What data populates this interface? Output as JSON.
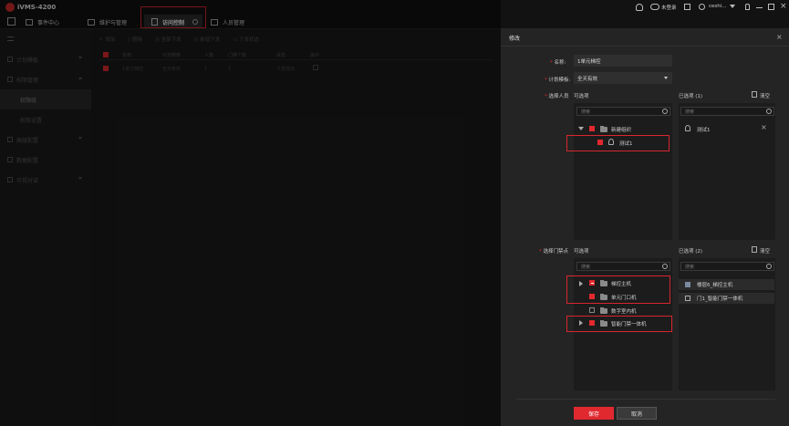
{
  "app": {
    "title": "iVMS-4200",
    "user": "ceshi...",
    "login_status": "未登录"
  },
  "tabs": [
    {
      "label": "事件中心"
    },
    {
      "label": "维护与管理"
    },
    {
      "label": "访问控制"
    },
    {
      "label": "人员管理"
    }
  ],
  "sidebar": {
    "items": [
      {
        "label": "计划模板"
      },
      {
        "label": "权限管理"
      },
      {
        "label": "权限组"
      },
      {
        "label": "权限设置"
      },
      {
        "label": "高级配置"
      },
      {
        "label": "数据配置"
      },
      {
        "label": "可视对讲"
      }
    ]
  },
  "toolbar": {
    "add": "添加",
    "delete": "删除",
    "apply_all": "全部下发",
    "apply_changes": "新增下发",
    "apply_status": "下发状态"
  },
  "table": {
    "columns": [
      "名称",
      "计划模板",
      "人数",
      "门禁个数",
      "状态",
      "操作"
    ],
    "rows": [
      {
        "name": "1单元梯控",
        "template": "全天有效",
        "people": "1",
        "doors": "2",
        "status": "下发成功"
      }
    ]
  },
  "drawer": {
    "title": "修改",
    "name_label": "名称:",
    "name_value": "1单元梯控",
    "template_label": "计划模板:",
    "template_value": "全天有效",
    "person_label": "选择人员",
    "door_label": "选择门禁点",
    "available": "可选项",
    "selected_persons": "已选项 (1)",
    "selected_doors": "已选项 (2)",
    "clear": "清空",
    "search_placeholder": "搜索",
    "person_tree": {
      "org": "新建组织",
      "person": "测试1"
    },
    "person_selected": [
      "测试1"
    ],
    "door_tree": [
      "梯控主机",
      "单元门口机",
      "数字室内机",
      "智能门禁一体机"
    ],
    "door_selected": [
      "楼层6_梯控主机",
      "门1_智能门禁一体机"
    ],
    "save": "保存",
    "cancel": "取消"
  },
  "colors": {
    "accent": "#e0292f",
    "highlight": "#d8262e"
  }
}
